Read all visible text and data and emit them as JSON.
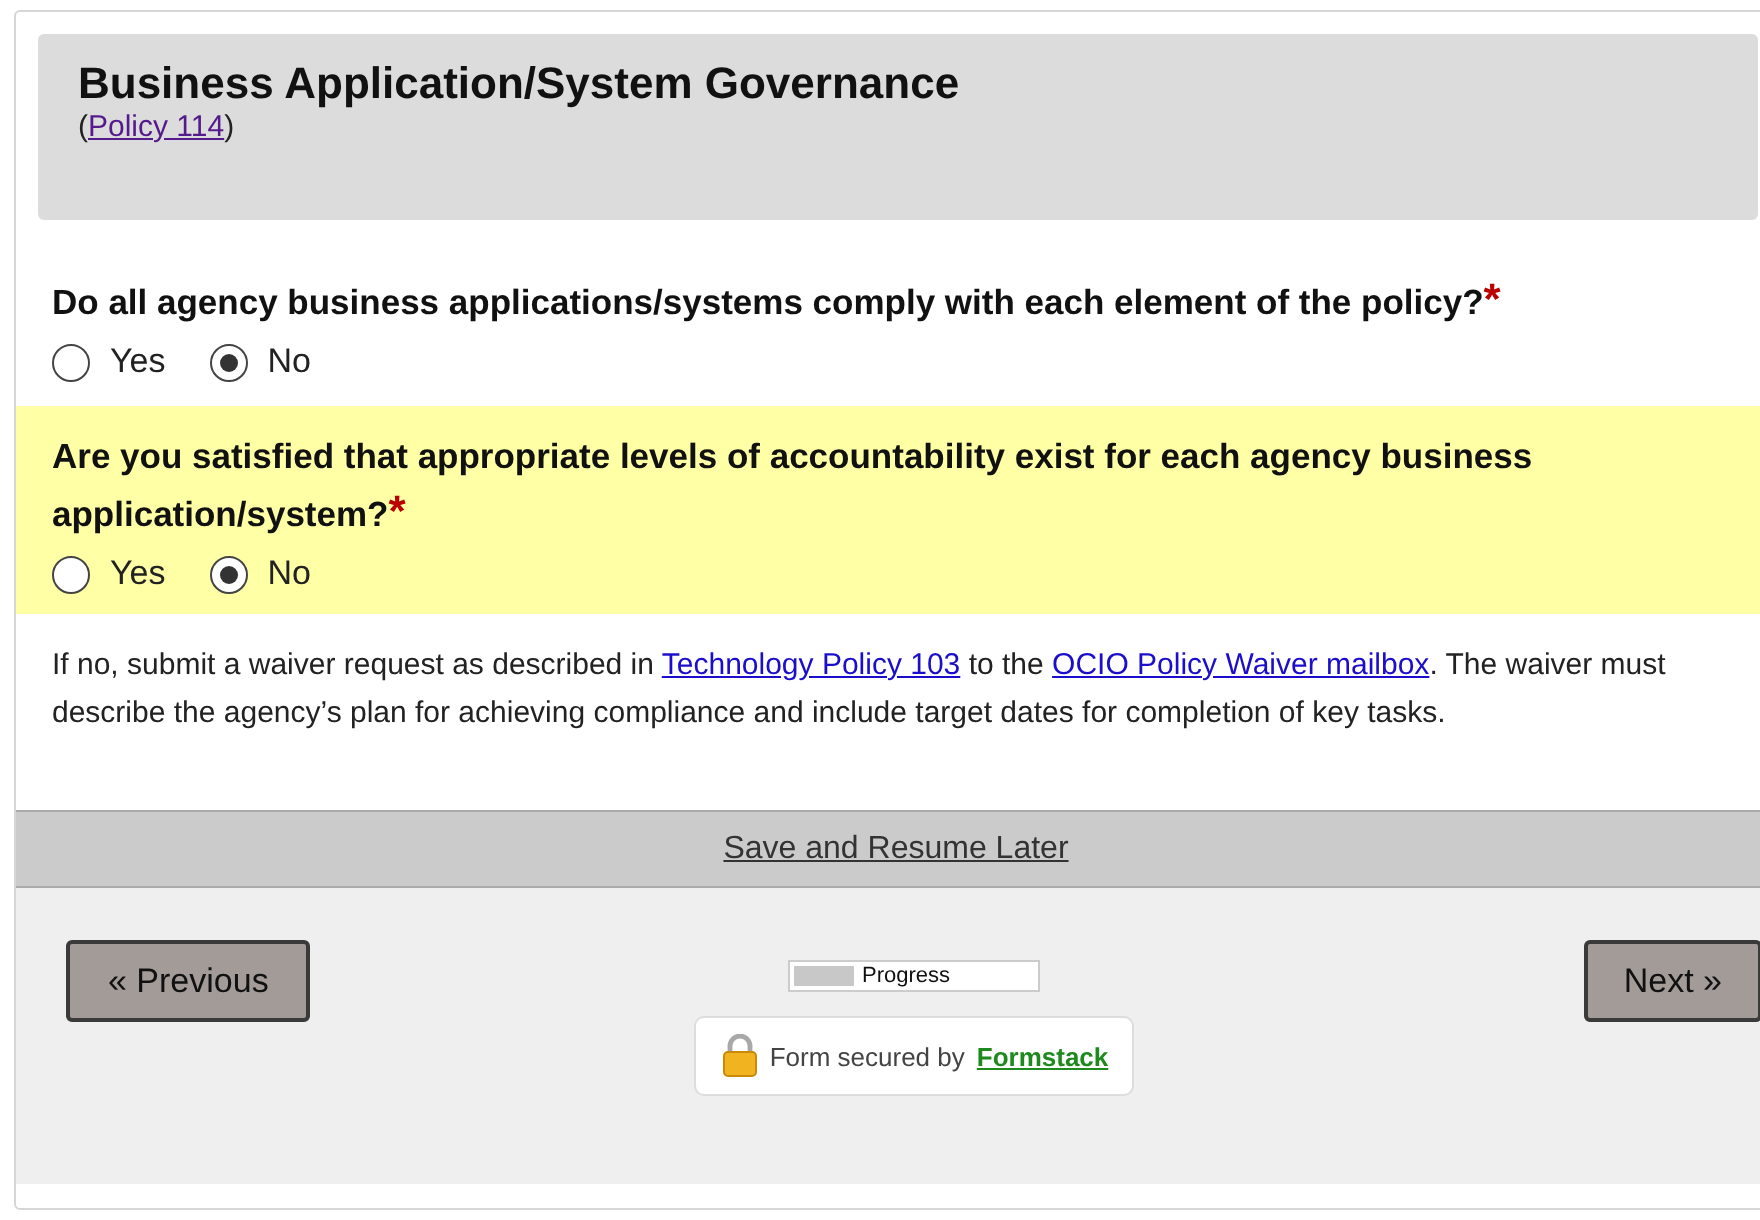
{
  "section": {
    "title": "Business Application/System Governance",
    "policy_link": {
      "before": "(",
      "label": "Policy 114",
      "after": ")"
    }
  },
  "questions": [
    {
      "text": "Do all agency business applications/systems comply with each element of the policy?",
      "required_mark": "*",
      "highlighted": false,
      "options": [
        {
          "label": "Yes",
          "selected": false
        },
        {
          "label": "No",
          "selected": true
        }
      ]
    },
    {
      "text": "Are you satisfied that appropriate levels of accountability exist for each agency business application/system?",
      "required_mark": "*",
      "highlighted": true,
      "options": [
        {
          "label": "Yes",
          "selected": false
        },
        {
          "label": "No",
          "selected": true
        }
      ]
    }
  ],
  "note": [
    {
      "kind": "text",
      "text": "If no, submit a waiver request as described in "
    },
    {
      "kind": "link",
      "text": "Technology Policy 103"
    },
    {
      "kind": "text",
      "text": " to the "
    },
    {
      "kind": "link",
      "text": "OCIO Policy Waiver mailbox"
    },
    {
      "kind": "text",
      "text": ". The waiver must describe the agency’s plan for achieving compliance and include target dates for completion of key tasks."
    }
  ],
  "save_link": "Save and Resume Later",
  "nav": {
    "previous": "« Previous",
    "next": "Next »"
  },
  "progress": {
    "label": "Progress",
    "level": 0.25
  },
  "secured": {
    "text": "Form secured by",
    "brand": "Formstack"
  }
}
